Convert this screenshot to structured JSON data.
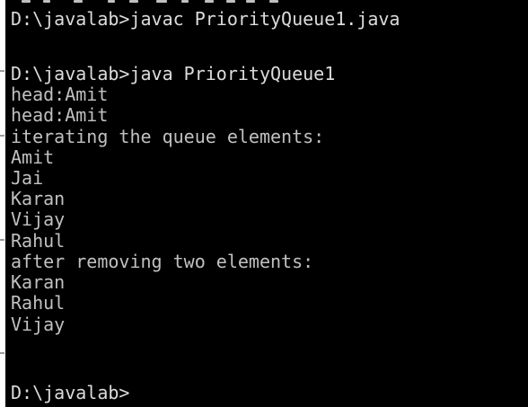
{
  "console": {
    "background": "#000000",
    "text_color": "#c0c0c0",
    "lines": [
      "D:\\javalab>javac PriorityQueue1.java",
      "",
      "D:\\javalab>java PriorityQueue1",
      "head:Amit",
      "head:Amit",
      "iterating the queue elements:",
      "Amit",
      "Jai",
      "Karan",
      "Vijay",
      "Rahul",
      "after removing two elements:",
      "Karan",
      "Rahul",
      "Vijay",
      "",
      "D:\\javalab>"
    ]
  }
}
